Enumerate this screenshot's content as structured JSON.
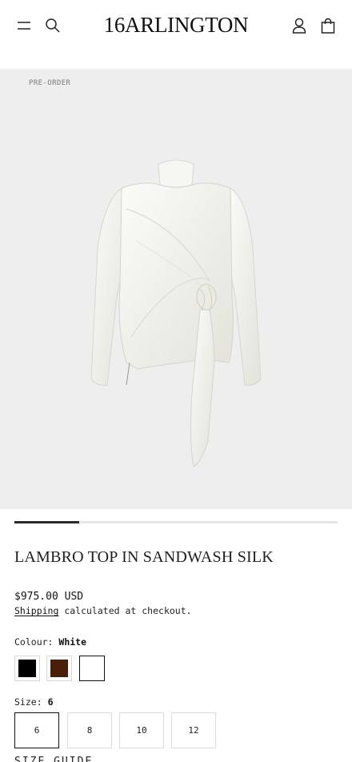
{
  "header": {
    "logo": "16ARLINGTON",
    "icons": [
      "menu-icon",
      "search-icon",
      "account-icon",
      "bag-icon"
    ]
  },
  "gallery": {
    "badge": "PRE-ORDER",
    "progress": 0.2
  },
  "product": {
    "title": "LAMBRO TOP IN SANDWASH SILK",
    "price": "$975.00 USD",
    "shipping_link": "Shipping",
    "shipping_text": " calculated at checkout."
  },
  "colour": {
    "label": "Colour:",
    "selected": "White",
    "swatches": [
      {
        "name": "Black",
        "hex": "#000000"
      },
      {
        "name": "Brown",
        "hex": "#4a1f0a"
      },
      {
        "name": "White",
        "hex": "#ffffff"
      }
    ]
  },
  "size": {
    "label": "Size:",
    "selected": "6",
    "options": [
      "6",
      "8",
      "10",
      "12"
    ]
  },
  "size_guide": "SIZE GUIDE"
}
